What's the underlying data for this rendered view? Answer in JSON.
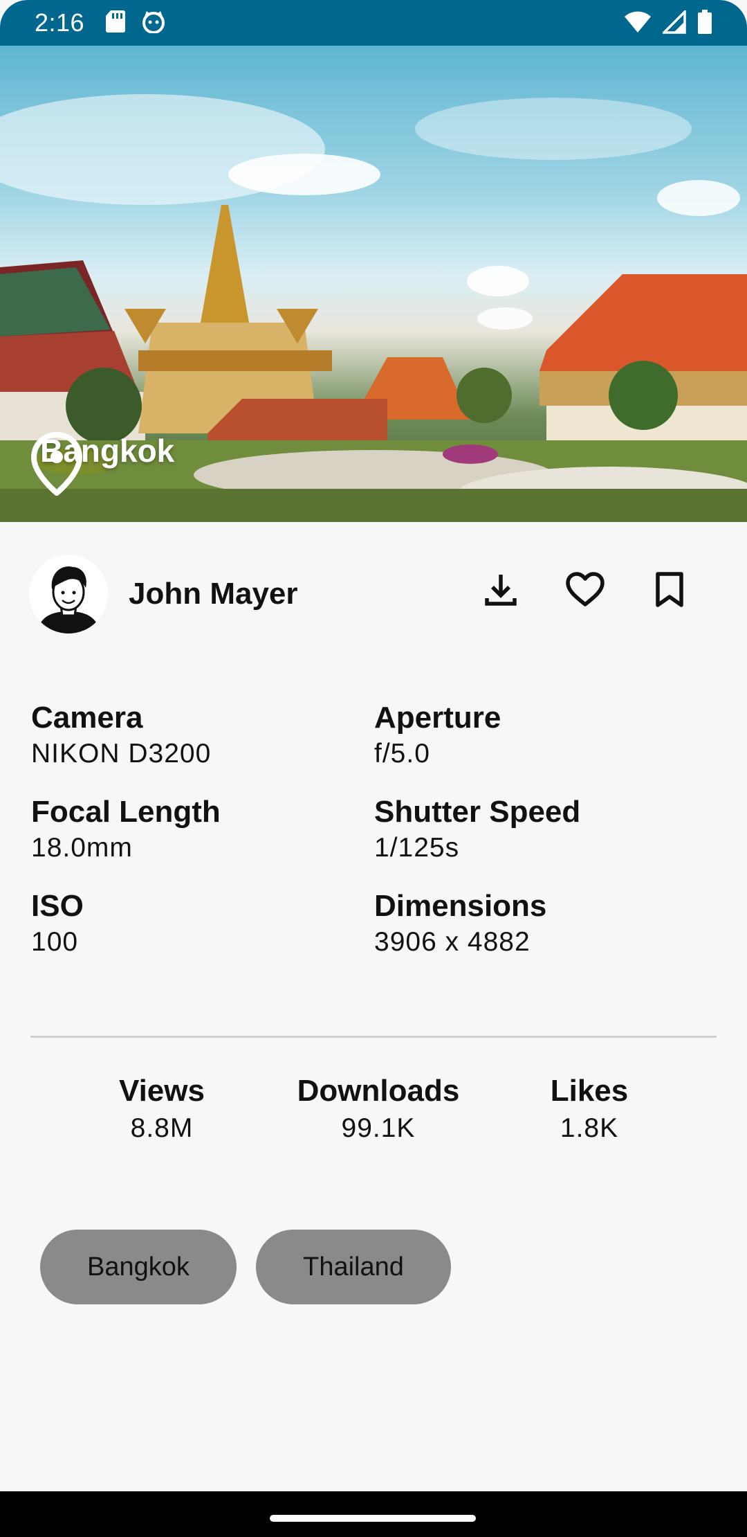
{
  "status_bar": {
    "time": "2:16",
    "left_icons": [
      "sd-card-icon",
      "cat-face-icon"
    ],
    "right_icons": [
      "wifi-icon",
      "signal-icon",
      "battery-icon"
    ]
  },
  "hero": {
    "location": "Bangkok",
    "location_icon": "location-pin-icon"
  },
  "author": {
    "name": "John Mayer",
    "actions": [
      {
        "name": "download-icon"
      },
      {
        "name": "heart-icon"
      },
      {
        "name": "bookmark-icon"
      }
    ]
  },
  "specs": [
    {
      "label": "Camera",
      "value": "NIKON D3200"
    },
    {
      "label": "Aperture",
      "value": "f/5.0"
    },
    {
      "label": "Focal Length",
      "value": "18.0mm"
    },
    {
      "label": "Shutter Speed",
      "value": "1/125s"
    },
    {
      "label": "ISO",
      "value": "100"
    },
    {
      "label": "Dimensions",
      "value": "3906 x 4882"
    }
  ],
  "stats": [
    {
      "label": "Views",
      "value": "8.8M"
    },
    {
      "label": "Downloads",
      "value": "99.1K"
    },
    {
      "label": "Likes",
      "value": "1.8K"
    }
  ],
  "tags": [
    "Bangkok",
    "Thailand"
  ],
  "colors": {
    "status_bar": "#00678f",
    "background": "#f7f7f7",
    "tag_background": "#8a8a8a"
  }
}
